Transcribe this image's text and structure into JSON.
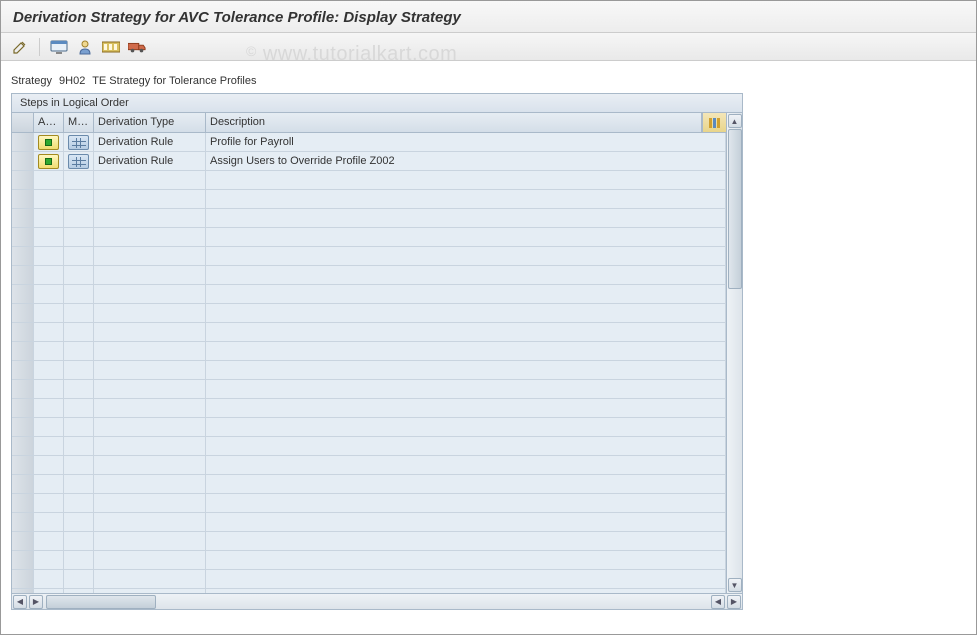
{
  "title": "Derivation Strategy for AVC Tolerance Profile: Display Strategy",
  "watermark": "© www.tutorialkart.com",
  "toolbar": {
    "icons": [
      "edit",
      "display",
      "user",
      "overview",
      "transport"
    ]
  },
  "strategy": {
    "label": "Strategy",
    "code": "9H02",
    "text": "TE Strategy for Tolerance Profiles"
  },
  "panel": {
    "title": "Steps in Logical Order",
    "columns": {
      "active": "Ac...",
      "maint": "Ma...",
      "type": "Derivation Type",
      "desc": "Description"
    },
    "rows": [
      {
        "type": "Derivation Rule",
        "desc": "Profile for Payroll"
      },
      {
        "type": "Derivation Rule",
        "desc": "Assign Users to Override Profile Z002"
      }
    ],
    "empty_row_count": 23
  }
}
